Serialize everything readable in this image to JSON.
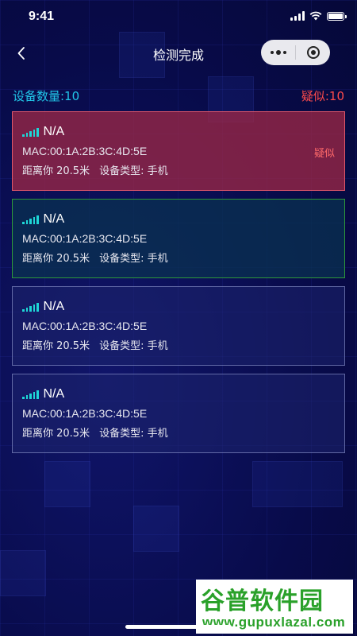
{
  "status_bar": {
    "time": "9:41"
  },
  "nav": {
    "title": "检测完成"
  },
  "summary": {
    "device_count": "设备数量:10",
    "suspect_count": "疑似:10"
  },
  "devices": [
    {
      "name": "N/A",
      "mac": "MAC:00:1A:2B:3C:4D:5E",
      "distance": "距离你 20.5米",
      "type": "设备类型: 手机",
      "badge": "疑似",
      "status": "suspect"
    },
    {
      "name": "N/A",
      "mac": "MAC:00:1A:2B:3C:4D:5E",
      "distance": "距离你 20.5米",
      "type": "设备类型: 手机",
      "status": "safe"
    },
    {
      "name": "N/A",
      "mac": "MAC:00:1A:2B:3C:4D:5E",
      "distance": "距离你 20.5米",
      "type": "设备类型: 手机",
      "status": "normal"
    },
    {
      "name": "N/A",
      "mac": "MAC:00:1A:2B:3C:4D:5E",
      "distance": "距离你 20.5米",
      "type": "设备类型: 手机",
      "status": "normal"
    }
  ],
  "watermark": {
    "brand": "谷普软件园",
    "url": "www.gupuxlazal.com"
  },
  "colors": {
    "accent_cyan": "#21c6e8",
    "danger_red": "#ff4b4b",
    "safe_green": "#2e9a3a",
    "background": "#080b4a"
  }
}
